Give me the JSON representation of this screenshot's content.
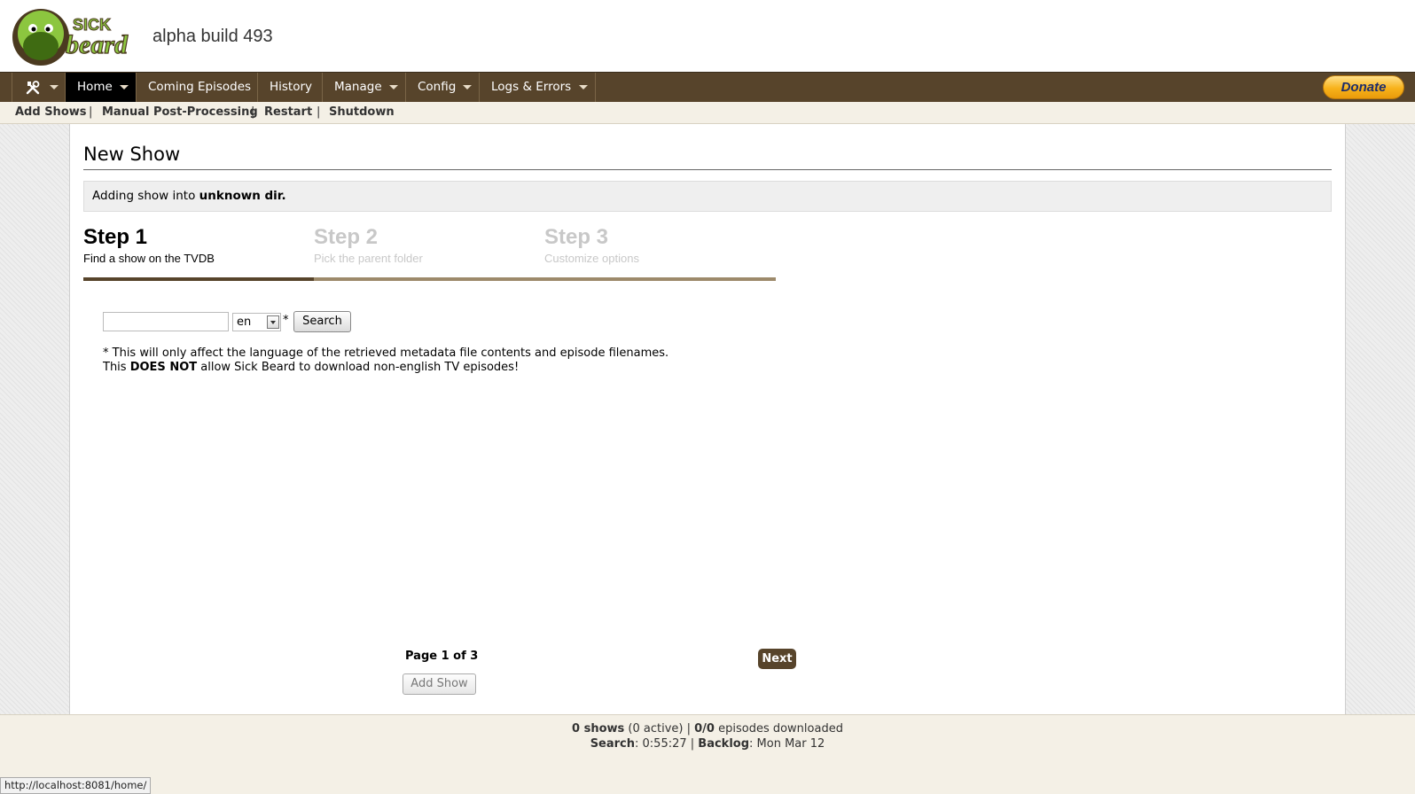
{
  "header": {
    "logo_text_top": "SICK",
    "logo_text_bottom": "beard",
    "build": "alpha build 493"
  },
  "nav": {
    "items": [
      {
        "label": "Home",
        "active": true
      },
      {
        "label": "Coming Episodes"
      },
      {
        "label": "History"
      },
      {
        "label": "Manage"
      },
      {
        "label": "Config"
      },
      {
        "label": "Logs & Errors"
      }
    ],
    "donate": "Donate"
  },
  "subnav": {
    "items": [
      "Add Shows",
      "Manual Post-Processing",
      "Restart",
      "Shutdown"
    ],
    "separator": "|"
  },
  "main": {
    "title": "New Show",
    "adding_prefix": "Adding show into ",
    "adding_dir": "unknown dir.",
    "steps": [
      {
        "title": "Step 1",
        "desc": "Find a show on the TVDB"
      },
      {
        "title": "Step 2",
        "desc": "Pick the parent folder"
      },
      {
        "title": "Step 3",
        "desc": "Customize options"
      }
    ],
    "search": {
      "value": "",
      "language": "en",
      "asterisk": "*",
      "button": "Search"
    },
    "note": {
      "line1": "* This will only affect the language of the retrieved metadata file contents and episode filenames.",
      "line2_prefix": "This ",
      "line2_bold": "DOES NOT",
      "line2_suffix": " allow Sick Beard to download non-english TV episodes!"
    },
    "page_indicator": "Page 1 of 3",
    "next": "Next",
    "add_show": "Add Show"
  },
  "footer": {
    "shows": "0 shows",
    "active": " (0 active) | ",
    "episodes": "0/0",
    "episodes_label": " episodes downloaded",
    "search_label": "Search",
    "search_value": ": 0:55:27 | ",
    "backlog_label": "Backlog",
    "backlog_value": ": Mon Mar 12"
  },
  "statusbar": "http://localhost:8081/home/",
  "colors": {
    "nav_bg": "#57442b",
    "accent": "#57442b",
    "subnav_bg": "#f4f0e6",
    "logo_green": "#8cc63f"
  }
}
